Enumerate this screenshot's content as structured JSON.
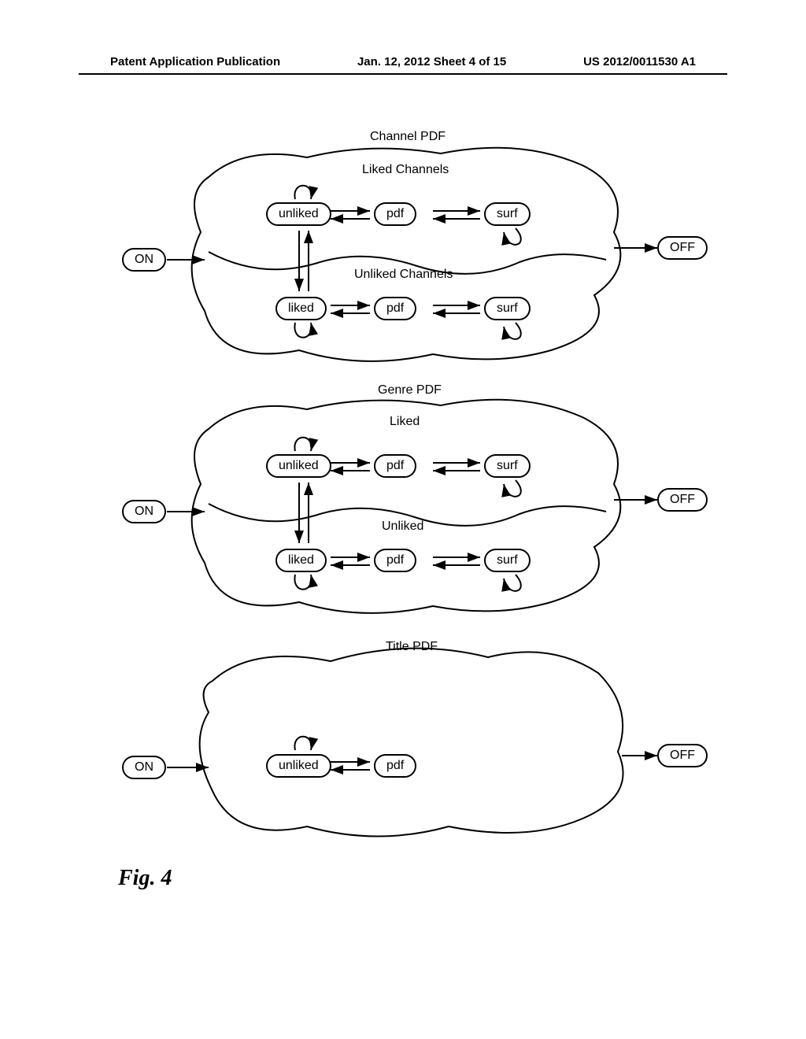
{
  "header": {
    "left": "Patent Application Publication",
    "center": "Jan. 12, 2012  Sheet 4 of 15",
    "right": "US 2012/0011530 A1"
  },
  "group1": {
    "title": "Channel PDF",
    "liked_label": "Liked Channels",
    "unliked_label": "Unliked Channels",
    "on": "ON",
    "off": "OFF",
    "s_unliked": "unliked",
    "s_pdf1": "pdf",
    "s_surf1": "surf",
    "s_liked": "liked",
    "s_pdf2": "pdf",
    "s_surf2": "surf"
  },
  "group2": {
    "title": "Genre PDF",
    "liked_label": "Liked",
    "unliked_label": "Unliked",
    "on": "ON",
    "off": "OFF",
    "s_unliked": "unliked",
    "s_pdf1": "pdf",
    "s_surf1": "surf",
    "s_liked": "liked",
    "s_pdf2": "pdf",
    "s_surf2": "surf"
  },
  "group3": {
    "title": "Title PDF",
    "on": "ON",
    "off": "OFF",
    "s_unliked": "unliked",
    "s_pdf": "pdf"
  },
  "figure_caption": "Fig. 4"
}
